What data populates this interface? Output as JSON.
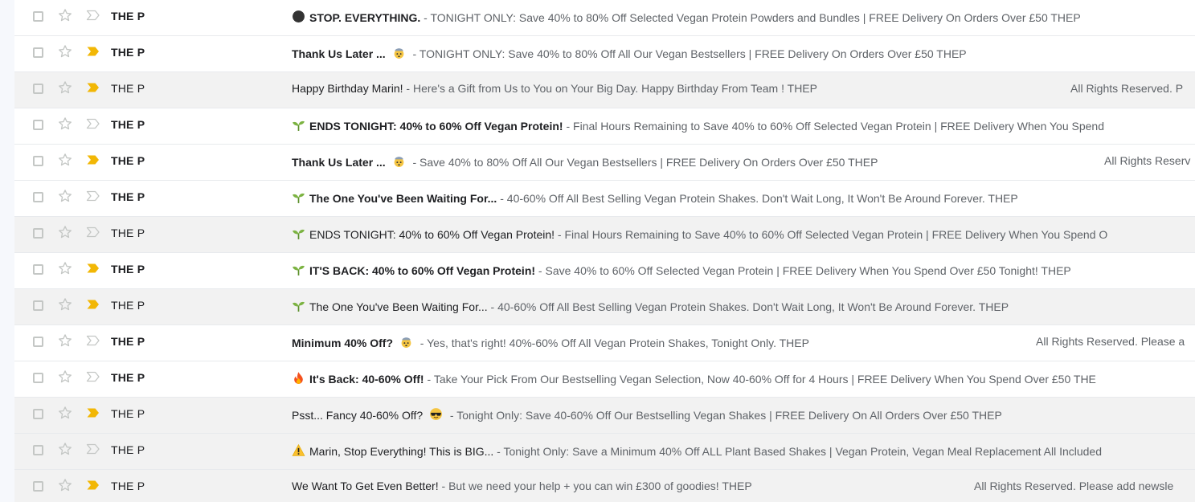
{
  "emails": [
    {
      "sender": "THE P",
      "emoji": "black-circle",
      "subject": "STOP. EVERYTHING.",
      "snippet": "TONIGHT ONLY: Save 40% to 80% Off Selected Vegan Protein Powders and Bundles | FREE Delivery On Orders Over £50 THEP",
      "unread": true,
      "important": false
    },
    {
      "sender": "THE P",
      "emoji": "",
      "subject": "Thank Us Later ...",
      "subject_emoji": "exploding-head",
      "snippet": "TONIGHT ONLY: Save 40% to 80% Off All Our Vegan Bestsellers | FREE Delivery On Orders Over £50 THEP",
      "unread": true,
      "important": true
    },
    {
      "sender": "THE P",
      "emoji": "",
      "subject": "Happy Birthday Marin!",
      "snippet": "Here's a Gift from Us to You on Your Big Day. Happy Birthday From Team         ! THEP",
      "rights": "All Rights Reserved. P",
      "unread": false,
      "important": true
    },
    {
      "sender": "THE P",
      "emoji": "seedling",
      "subject": "ENDS TONIGHT: 40% to 60% Off Vegan Protein!",
      "snippet": "Final Hours Remaining to Save 40% to 60% Off Selected Vegan Protein | FREE Delivery When You Spend",
      "unread": true,
      "important": false
    },
    {
      "sender": "THE P",
      "emoji": "",
      "subject": "Thank Us Later ...",
      "subject_emoji": "exploding-head",
      "snippet": "Save 40% to 80% Off All Our Vegan Bestsellers | FREE Delivery On Orders Over £50 THEP",
      "rights": "All Rights Reserv",
      "unread": true,
      "important": true
    },
    {
      "sender": "THE P",
      "emoji": "seedling",
      "subject": "The One You've Been Waiting For...",
      "snippet": "40-60% Off All Best Selling Vegan Protein Shakes. Don't Wait Long, It Won't Be Around Forever. THEP",
      "unread": true,
      "important": false
    },
    {
      "sender": "THE P",
      "emoji": "seedling",
      "subject": "ENDS TONIGHT: 40% to 60% Off Vegan Protein!",
      "snippet": "Final Hours Remaining to Save 40% to 60% Off Selected Vegan Protein | FREE Delivery When You Spend O",
      "unread": false,
      "important": false
    },
    {
      "sender": "THE P",
      "emoji": "seedling",
      "subject": "IT'S BACK: 40% to 60% Off Vegan Protein!",
      "snippet": "Save 40% to 60% Off Selected Vegan Protein | FREE Delivery When You Spend Over £50 Tonight! THEP",
      "unread": true,
      "important": true
    },
    {
      "sender": "THE P",
      "emoji": "seedling",
      "subject": "The One You've Been Waiting For...",
      "snippet": "40-60% Off All Best Selling Vegan Protein Shakes. Don't Wait Long, It Won't Be Around Forever. THEP",
      "unread": false,
      "important": true
    },
    {
      "sender": "THE P",
      "emoji": "",
      "subject": "Minimum 40% Off?",
      "subject_emoji": "exploding-head",
      "snippet": "Yes, that's right! 40%-60% Off All Vegan Protein Shakes, Tonight Only. THEP",
      "rights": "All Rights Reserved. Please a",
      "unread": true,
      "important": false
    },
    {
      "sender": "THE P",
      "emoji": "fire",
      "subject": "It's Back: 40-60% Off!",
      "snippet": "Take Your Pick From Our Bestselling Vegan Selection, Now 40-60% Off for 4 Hours | FREE Delivery When You Spend Over £50 THE",
      "unread": true,
      "important": false
    },
    {
      "sender": "THE P",
      "emoji": "",
      "subject": "Psst... Fancy 40-60% Off?",
      "subject_emoji": "sunglasses",
      "snippet": "Tonight Only: Save 40-60% Off Our Bestselling Vegan Shakes | FREE Delivery On All Orders Over £50 THEP",
      "unread": false,
      "important": true
    },
    {
      "sender": "THE P",
      "emoji": "warning",
      "subject": "Marin, Stop Everything! This is BIG...",
      "snippet": "Tonight Only: Save a Minimum 40% Off ALL Plant Based Shakes | Vegan Protein, Vegan Meal Replacement All Included",
      "unread": false,
      "important": false
    },
    {
      "sender": "THE P",
      "emoji": "",
      "subject": "We Want To Get Even Better!",
      "snippet": "But we need your help + you can win £300 of goodies! THEP",
      "rights": "All Rights Reserved. Please add newsle",
      "unread": false,
      "important": true
    }
  ],
  "separator": " - ",
  "colors": {
    "important_active": "#f2b705",
    "important_inactive": "#c4c7c5",
    "unread_bg": "#ffffff",
    "read_bg": "#f2f2f2"
  }
}
